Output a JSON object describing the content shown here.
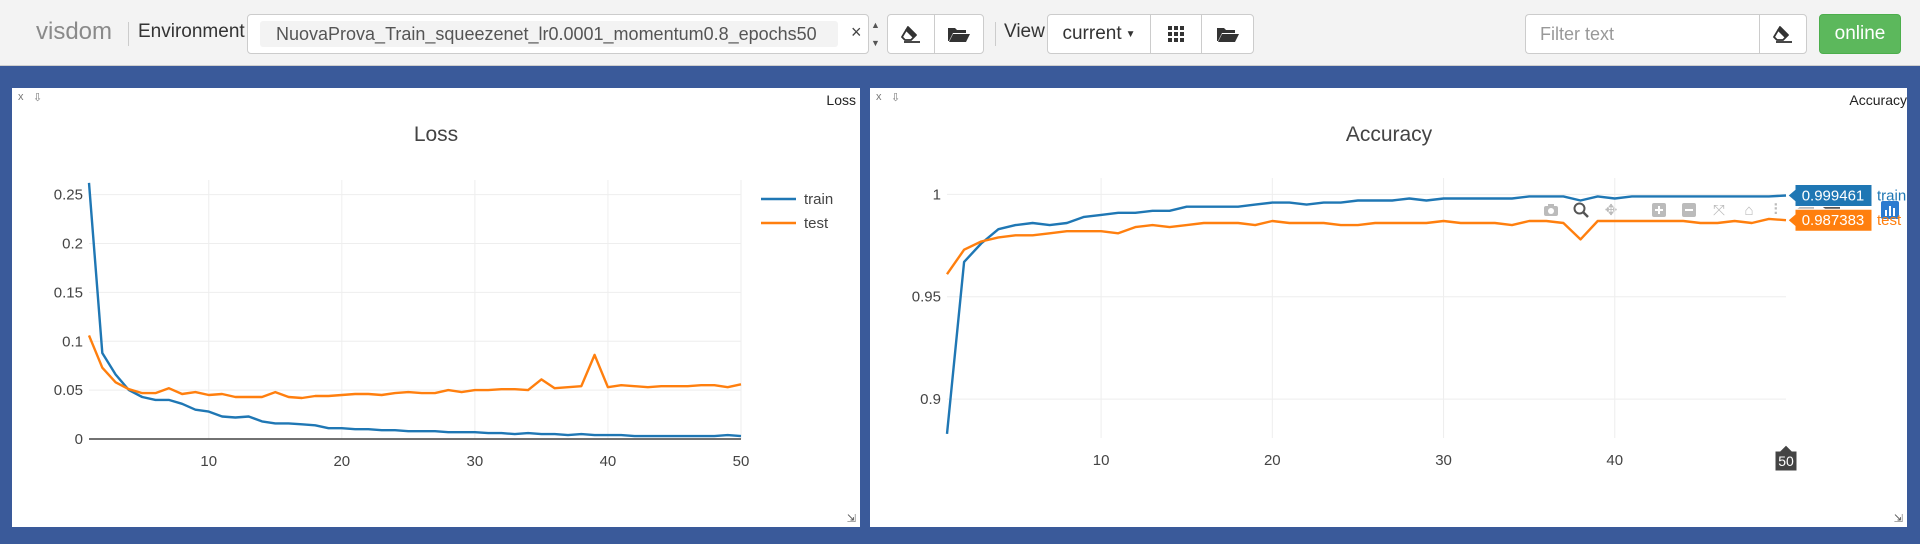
{
  "navbar": {
    "brand": "visdom",
    "environment_label": "Environment",
    "environment_value": "NuovaProva_Train_squeezenet_lr0.0001_momentum0.8_epochs50",
    "clear_symbol": "×",
    "view_label": "View",
    "view_value": "current",
    "filter_placeholder": "Filter text",
    "status_label": "online",
    "status_color": "#5cb85c"
  },
  "icons": {
    "eraser": "eraser-icon",
    "folder": "folder-open-icon",
    "grid": "grid-icon",
    "dropdown": "caret-down-icon"
  },
  "panes": [
    {
      "window_title": "Loss",
      "close_symbol": "x",
      "pin_symbol": "⇩"
    },
    {
      "window_title": "Accuracy",
      "close_symbol": "x",
      "pin_symbol": "⇩"
    }
  ],
  "colors": {
    "train": "#1f77b4",
    "test": "#ff7f0e",
    "background": "#3a5a9a"
  },
  "chart_data": [
    {
      "type": "line",
      "title": "Loss",
      "xlabel": "",
      "ylabel": "",
      "xlim": [
        1,
        50
      ],
      "ylim": [
        0,
        0.265
      ],
      "xticks": [
        10,
        20,
        30,
        40,
        50
      ],
      "yticks": [
        0,
        0.05,
        0.1,
        0.15,
        0.2,
        0.25
      ],
      "ytick_labels": [
        "0",
        "0.05",
        "0.1",
        "0.15",
        "0.2",
        "0.25"
      ],
      "grid": true,
      "legend_position": "top-right",
      "x": [
        1,
        2,
        3,
        4,
        5,
        6,
        7,
        8,
        9,
        10,
        11,
        12,
        13,
        14,
        15,
        16,
        17,
        18,
        19,
        20,
        21,
        22,
        23,
        24,
        25,
        26,
        27,
        28,
        29,
        30,
        31,
        32,
        33,
        34,
        35,
        36,
        37,
        38,
        39,
        40,
        41,
        42,
        43,
        44,
        45,
        46,
        47,
        48,
        49,
        50
      ],
      "series": [
        {
          "name": "train",
          "values": [
            0.262,
            0.088,
            0.066,
            0.05,
            0.043,
            0.04,
            0.04,
            0.036,
            0.03,
            0.028,
            0.023,
            0.022,
            0.023,
            0.018,
            0.016,
            0.016,
            0.015,
            0.014,
            0.011,
            0.011,
            0.01,
            0.01,
            0.009,
            0.009,
            0.008,
            0.008,
            0.008,
            0.007,
            0.007,
            0.007,
            0.006,
            0.006,
            0.005,
            0.006,
            0.005,
            0.005,
            0.004,
            0.005,
            0.004,
            0.004,
            0.004,
            0.003,
            0.003,
            0.003,
            0.003,
            0.003,
            0.003,
            0.003,
            0.004,
            0.003
          ]
        },
        {
          "name": "test",
          "values": [
            0.106,
            0.073,
            0.058,
            0.051,
            0.047,
            0.047,
            0.052,
            0.046,
            0.048,
            0.045,
            0.046,
            0.043,
            0.043,
            0.043,
            0.048,
            0.043,
            0.042,
            0.044,
            0.044,
            0.045,
            0.046,
            0.046,
            0.045,
            0.047,
            0.048,
            0.047,
            0.047,
            0.05,
            0.048,
            0.05,
            0.05,
            0.051,
            0.051,
            0.05,
            0.061,
            0.052,
            0.053,
            0.054,
            0.086,
            0.053,
            0.055,
            0.054,
            0.053,
            0.054,
            0.054,
            0.054,
            0.055,
            0.055,
            0.053,
            0.056
          ]
        }
      ]
    },
    {
      "type": "line",
      "title": "Accuracy",
      "xlabel": "",
      "ylabel": "",
      "xlim": [
        1,
        50
      ],
      "ylim": [
        0.881,
        1.008
      ],
      "xticks": [
        10,
        20,
        30,
        40
      ],
      "yticks": [
        0.9,
        0.95,
        1
      ],
      "ytick_labels": [
        "0.9",
        "0.95",
        "1"
      ],
      "grid": true,
      "legend_position": "right",
      "hover_x_label": "50",
      "hover_labels": [
        "0.999461",
        "0.987383"
      ],
      "x": [
        1,
        2,
        3,
        4,
        5,
        6,
        7,
        8,
        9,
        10,
        11,
        12,
        13,
        14,
        15,
        16,
        17,
        18,
        19,
        20,
        21,
        22,
        23,
        24,
        25,
        26,
        27,
        28,
        29,
        30,
        31,
        32,
        33,
        34,
        35,
        36,
        37,
        38,
        39,
        40,
        41,
        42,
        43,
        44,
        45,
        46,
        47,
        48,
        49,
        50
      ],
      "series": [
        {
          "name": "train",
          "values": [
            0.883,
            0.967,
            0.976,
            0.983,
            0.985,
            0.986,
            0.985,
            0.986,
            0.989,
            0.99,
            0.991,
            0.991,
            0.992,
            0.992,
            0.994,
            0.994,
            0.994,
            0.994,
            0.995,
            0.996,
            0.996,
            0.995,
            0.996,
            0.996,
            0.997,
            0.997,
            0.997,
            0.998,
            0.997,
            0.998,
            0.998,
            0.998,
            0.998,
            0.998,
            0.999,
            0.999,
            0.999,
            0.997,
            0.999,
            0.998,
            0.999,
            0.999,
            0.999,
            0.999,
            0.999,
            0.999,
            0.999,
            0.999,
            0.999,
            0.999461
          ]
        },
        {
          "name": "test",
          "values": [
            0.961,
            0.973,
            0.977,
            0.979,
            0.98,
            0.98,
            0.981,
            0.982,
            0.982,
            0.982,
            0.981,
            0.984,
            0.985,
            0.984,
            0.985,
            0.986,
            0.986,
            0.986,
            0.985,
            0.987,
            0.986,
            0.986,
            0.986,
            0.985,
            0.985,
            0.986,
            0.986,
            0.986,
            0.986,
            0.987,
            0.986,
            0.986,
            0.986,
            0.985,
            0.987,
            0.987,
            0.986,
            0.978,
            0.987,
            0.987,
            0.987,
            0.987,
            0.987,
            0.987,
            0.986,
            0.986,
            0.987,
            0.986,
            0.988,
            0.987383
          ]
        }
      ]
    }
  ]
}
